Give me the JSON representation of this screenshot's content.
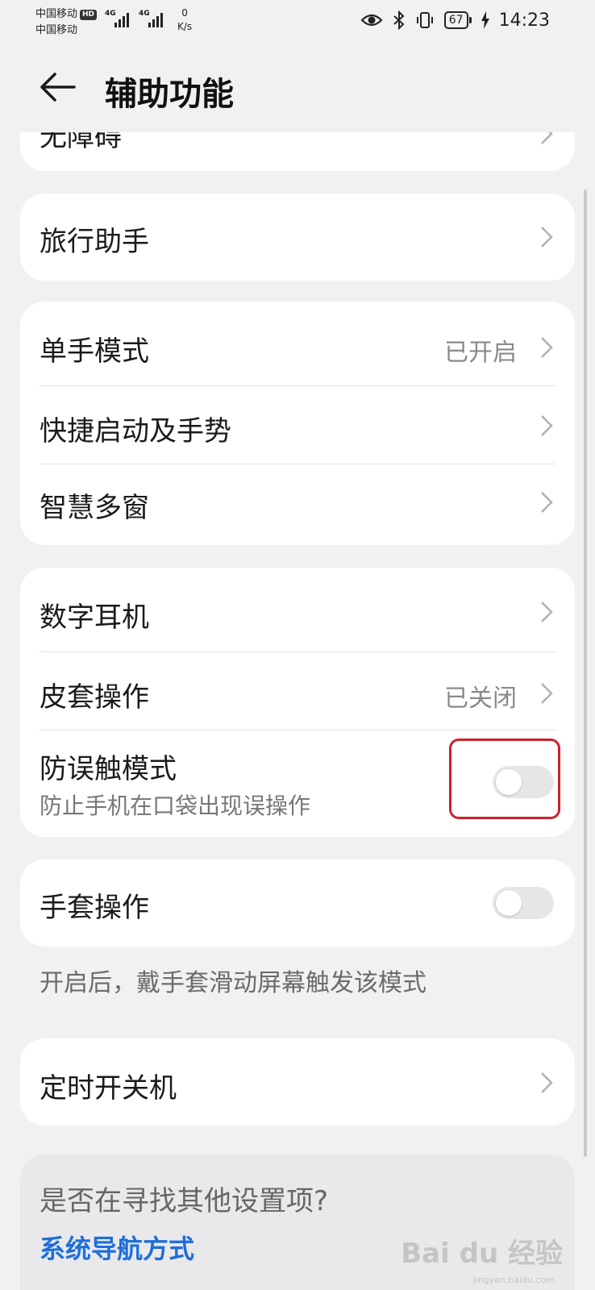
{
  "status_bar": {
    "carrier1": "中国移动",
    "carrier1_badge": "HD",
    "carrier2": "中国移动",
    "net1": "4G",
    "net2": "4G",
    "speed_value": "0",
    "speed_unit": "K/s",
    "battery": "67",
    "time": "14:23"
  },
  "header": {
    "title": "辅助功能"
  },
  "partial_item": {
    "label": "无障碍"
  },
  "travel": {
    "label": "旅行助手"
  },
  "group1": {
    "one_hand": {
      "label": "单手模式",
      "value": "已开启"
    },
    "shortcuts": {
      "label": "快捷启动及手势"
    },
    "multi_window": {
      "label": "智慧多窗"
    }
  },
  "group2": {
    "digital_earphone": {
      "label": "数字耳机"
    },
    "cover": {
      "label": "皮套操作",
      "value": "已关闭"
    },
    "pocket_mode": {
      "label": "防误触模式",
      "subtitle": "防止手机在口袋出现误操作",
      "enabled": false
    }
  },
  "glove": {
    "label": "手套操作",
    "enabled": false,
    "note": "开启后，戴手套滑动屏幕触发该模式"
  },
  "timer": {
    "label": "定时开关机"
  },
  "search_prompt": {
    "question": "是否在寻找其他设置项?",
    "link": "系统导航方式"
  },
  "watermark": {
    "text": "Bai du 经验",
    "sub": "jingyan.baidu.com"
  }
}
